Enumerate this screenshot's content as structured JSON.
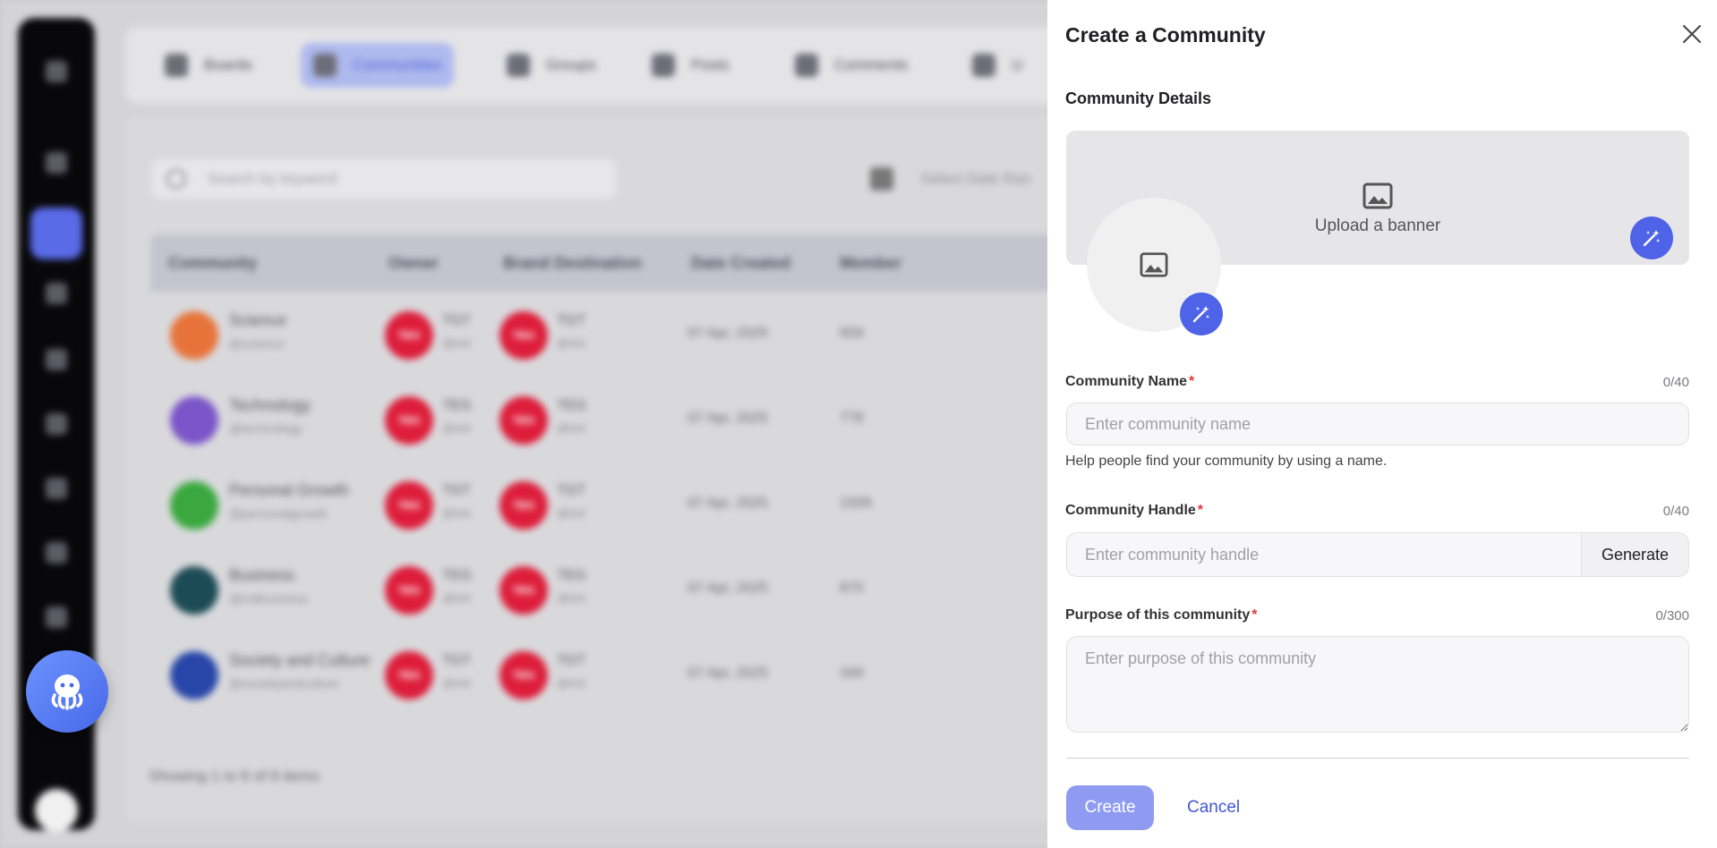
{
  "colors": {
    "accent": "#4f63e8",
    "create_disabled": "#8e9bf0",
    "required": "#e03a3a",
    "sidebar": "#08080a",
    "owner_badge": "#dd1d3a"
  },
  "background": {
    "nav_tabs": [
      {
        "label": "Boards",
        "icon": "boards-icon"
      },
      {
        "label": "Communities",
        "icon": "communities-icon",
        "active": true
      },
      {
        "label": "Groups",
        "icon": "groups-icon"
      },
      {
        "label": "Posts",
        "icon": "posts-icon"
      },
      {
        "label": "Comments",
        "icon": "comments-icon"
      },
      {
        "label": "U",
        "icon": "users-icon"
      }
    ],
    "search_placeholder": "Search by keyword",
    "date_placeholder": "Select Date Ran",
    "columns": [
      "Community",
      "Owner",
      "Brand Destination",
      "Date Created",
      "Member"
    ],
    "rows": [
      {
        "name": "Science",
        "handle": "@science",
        "color": "#e8733a",
        "owner": "TGT",
        "owner_handle": "@tod",
        "brand": "TGT",
        "brand_handle": "@tod",
        "date": "07 Apr, 2025",
        "members": "659"
      },
      {
        "name": "Technology",
        "handle": "@technology",
        "color": "#7b55c9",
        "owner": "TEG",
        "owner_handle": "@tod",
        "brand": "TEG",
        "brand_handle": "@tod",
        "date": "07 Apr, 2025",
        "members": "778"
      },
      {
        "name": "Personal Growth",
        "handle": "@personalgrowth",
        "color": "#3aa83e",
        "owner": "TGT",
        "owner_handle": "@tod",
        "brand": "TGT",
        "brand_handle": "@tod",
        "date": "07 Apr, 2025",
        "members": "1509"
      },
      {
        "name": "Business",
        "handle": "@indbusiness",
        "color": "#1d4b55",
        "owner": "TEG",
        "owner_handle": "@tod",
        "brand": "TEG",
        "brand_handle": "@tod",
        "date": "07 Apr, 2025",
        "members": "870"
      },
      {
        "name": "Society and Culture",
        "handle": "@societyandculture",
        "color": "#2746a8",
        "owner": "TGT",
        "owner_handle": "@tod",
        "brand": "TGT",
        "brand_handle": "@tod",
        "date": "07 Apr, 2025",
        "members": "349"
      }
    ],
    "showing_text": "Showing 1 to 8 of 8 items"
  },
  "drawer": {
    "title": "Create a Community",
    "close_icon": "close-icon",
    "section_title": "Community Details",
    "banner_label": "Upload a banner",
    "name": {
      "label": "Community Name",
      "required_mark": "*",
      "counter": "0/40",
      "placeholder": "Enter community name",
      "value": "",
      "helper": "Help people find your community by using a name."
    },
    "handle": {
      "label": "Community Handle",
      "required_mark": "*",
      "counter": "0/40",
      "placeholder": "Enter community handle",
      "value": "",
      "generate_label": "Generate"
    },
    "purpose": {
      "label": "Purpose of this community",
      "required_mark": "*",
      "counter": "0/300",
      "placeholder": "Enter purpose of this community",
      "value": ""
    },
    "create_label": "Create",
    "cancel_label": "Cancel"
  }
}
